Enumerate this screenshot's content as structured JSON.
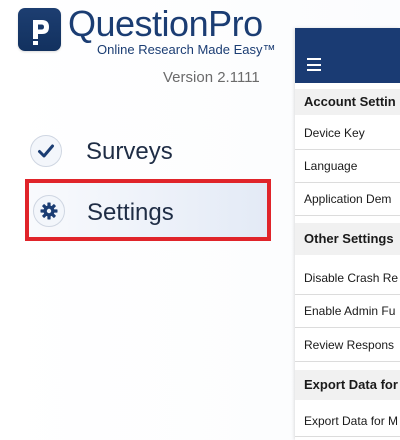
{
  "brand": {
    "name": "QuestionPro",
    "tagline": "Online Research Made Easy™",
    "version": "Version 2.1111"
  },
  "menu": {
    "items": [
      {
        "label": "Surveys",
        "icon": "checkmark-icon",
        "selected": false
      },
      {
        "label": "Settings",
        "icon": "gear-icon",
        "selected": true
      }
    ],
    "highlight_color": "#e0242a"
  },
  "settings_panel": {
    "header_color": "#1a3b73",
    "sections": [
      {
        "title": "Account Settin",
        "rows": [
          "Device Key",
          "Language",
          "Application Dem"
        ]
      },
      {
        "title": "Other Settings",
        "rows": [
          "Disable Crash Re",
          "Enable Admin Fu",
          "Review Respons"
        ]
      },
      {
        "title": "Export Data for",
        "rows": [
          "Export Data for M"
        ]
      }
    ]
  }
}
